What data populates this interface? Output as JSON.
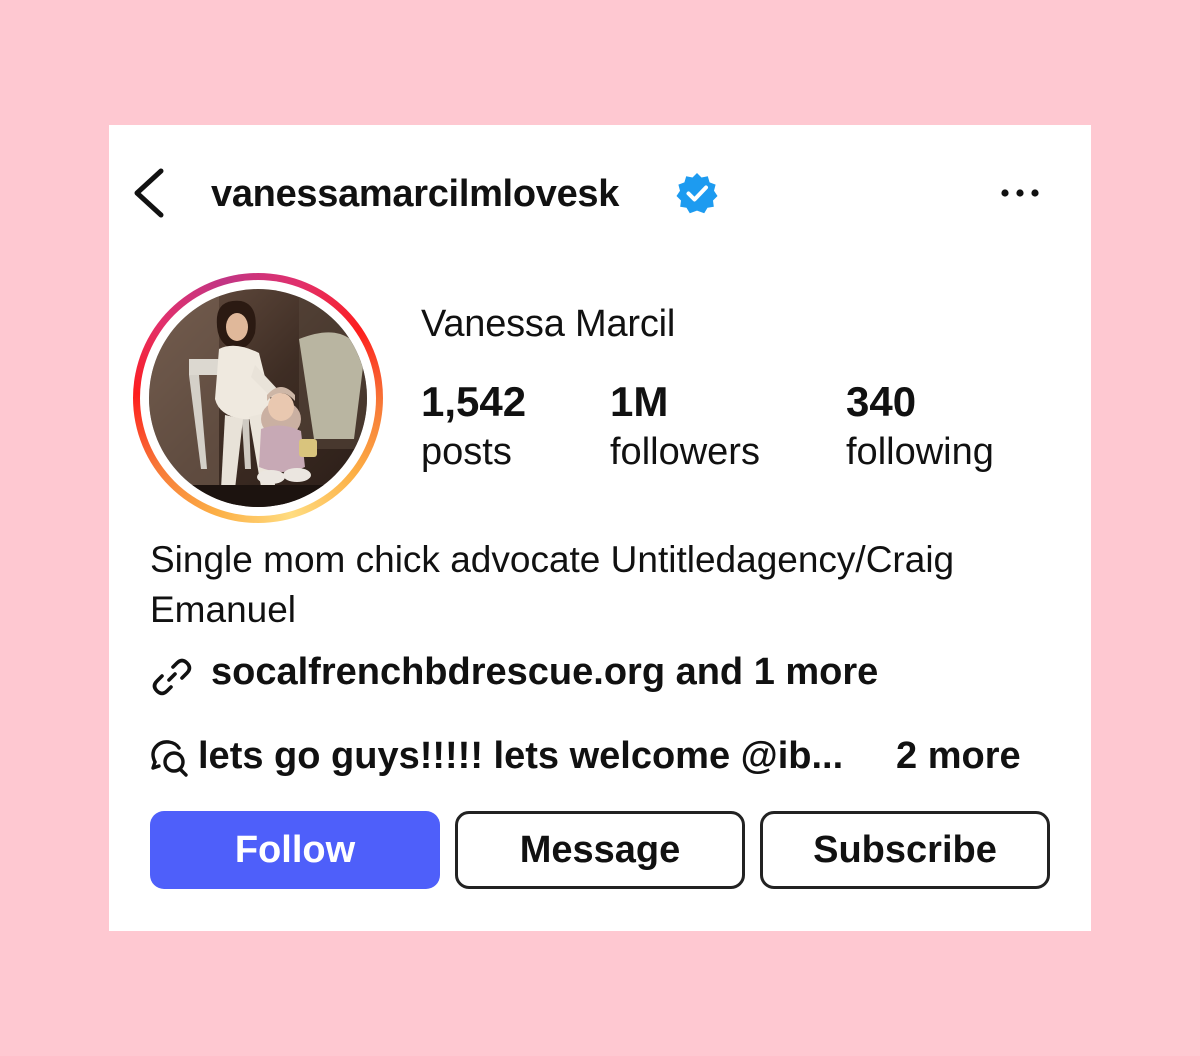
{
  "header": {
    "username": "vanessamarcilmlovesk",
    "verified": true,
    "back_icon": "chevron-left-icon",
    "more_icon": "more-horizontal-icon"
  },
  "profile": {
    "display_name": "Vanessa Marcil",
    "avatar_description": "profile photo",
    "stats": {
      "posts": {
        "count": "1,542",
        "label": "posts"
      },
      "followers": {
        "count": "1M",
        "label": "followers"
      },
      "following": {
        "count": "340",
        "label": "following"
      }
    },
    "bio": "Single mom chick advocate Untitledagency/Craig Emanuel",
    "link": {
      "icon": "link-icon",
      "text": "socalfrenchbdrescue.org and 1 more"
    },
    "threads": {
      "icon": "threads-icon",
      "text": "lets go guys!!!!! lets welcome @ib...",
      "more": "2 more"
    }
  },
  "actions": {
    "follow": "Follow",
    "message": "Message",
    "subscribe": "Subscribe"
  },
  "colors": {
    "background": "#fec8d1",
    "follow_button": "#4e5ffa",
    "verified_badge": "#1d9bf0"
  }
}
